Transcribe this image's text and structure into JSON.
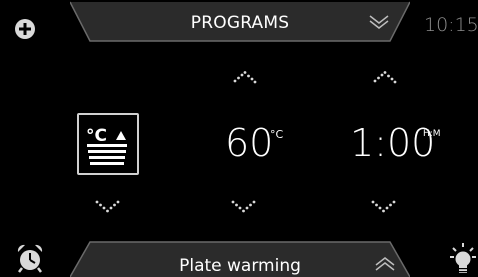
{
  "header": {
    "title": "PROGRAMS",
    "clock": "10:15"
  },
  "settings": {
    "temperature": "60",
    "temperature_unit": "°C",
    "duration": "1:00",
    "duration_unit": "H:M"
  },
  "mode_icon_label": "°C",
  "footer": {
    "program_name": "Plate warming"
  },
  "colors": {
    "background": "#000000",
    "tab_fill": "#2b2b2b",
    "tab_border": "#6a6a6a",
    "text": "#ffffff",
    "clock": "#8e8e8e",
    "alarm_icon": "#d9d9d9",
    "bulb_icon": "#d9d9d9"
  },
  "icons": {
    "top_left": "plus-icon",
    "top_tab": "chevron-down-double-icon",
    "bottom_tab": "chevron-up-double-icon",
    "bottom_left": "alarm-clock-icon",
    "bottom_right": "light-bulb-icon",
    "mode": "plate-warming-mode-icon"
  }
}
